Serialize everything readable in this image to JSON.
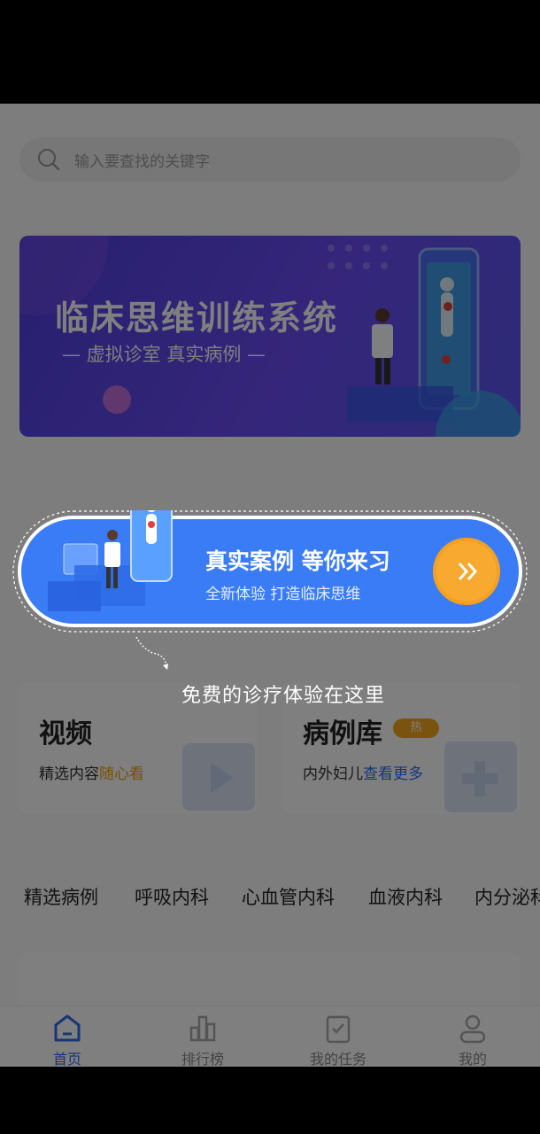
{
  "search": {
    "placeholder": "输入要查找的关键字"
  },
  "banner": {
    "title": "临床思维训练系统",
    "subtitle": "— 虚拟诊室 真实病例 —"
  },
  "promo": {
    "title": "真实案例 等你来习",
    "subtitle": "全新体验 打造临床思维",
    "go_icon": "double-chevron-right-icon"
  },
  "tip": "免费的诊疗体验在这里",
  "tiles": [
    {
      "title": "视频",
      "sub_plain": "精选内容",
      "sub_accent": "随心看"
    },
    {
      "title": "病例库",
      "badge": "热",
      "sub_plain": "内外妇儿",
      "sub_accent": "查看更多"
    }
  ],
  "categories": [
    "精选病例",
    "呼吸内科",
    "心血管内科",
    "血液内科",
    "内分泌科"
  ],
  "tabbar": [
    {
      "label": "首页",
      "icon": "home-icon"
    },
    {
      "label": "排行榜",
      "icon": "ranking-icon"
    },
    {
      "label": "我的任务",
      "icon": "task-icon"
    },
    {
      "label": "我的",
      "icon": "user-icon"
    }
  ],
  "colors": {
    "accent": "#2d6cf5",
    "orange": "#f39c12",
    "banner": "#5a48ea"
  }
}
